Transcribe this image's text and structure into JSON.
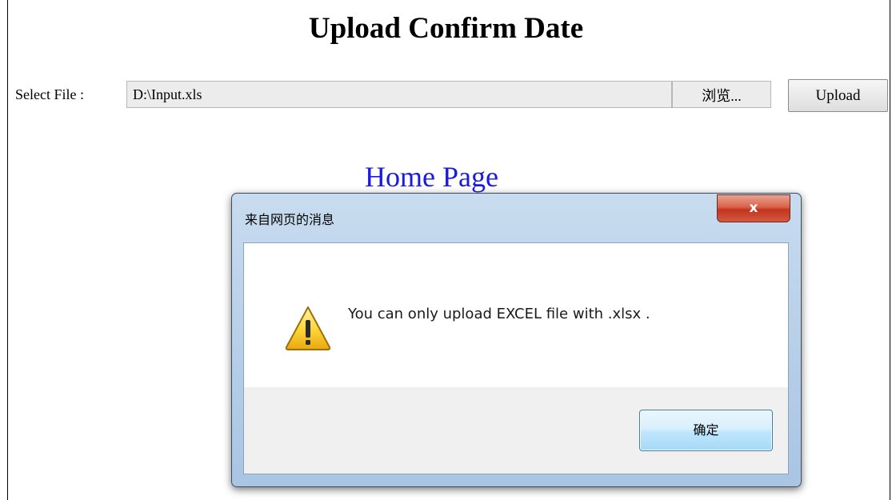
{
  "page": {
    "title": "Upload Confirm Date",
    "file_label": "Select File :",
    "file_input_value": "D:\\Input.xls",
    "browse_label": "浏览...",
    "upload_label": "Upload",
    "home_link": "Home Page"
  },
  "dialog": {
    "title": "来自网页的消息",
    "close_label": "x",
    "message": "You can only upload EXCEL file with .xlsx .",
    "ok_label": "确定",
    "icon": "warning-icon"
  },
  "colors": {
    "link": "#1a1ae0",
    "dialog_frame": "#bcd3ea",
    "close_button": "#c2341e",
    "ok_border": "#3c7fb1"
  }
}
